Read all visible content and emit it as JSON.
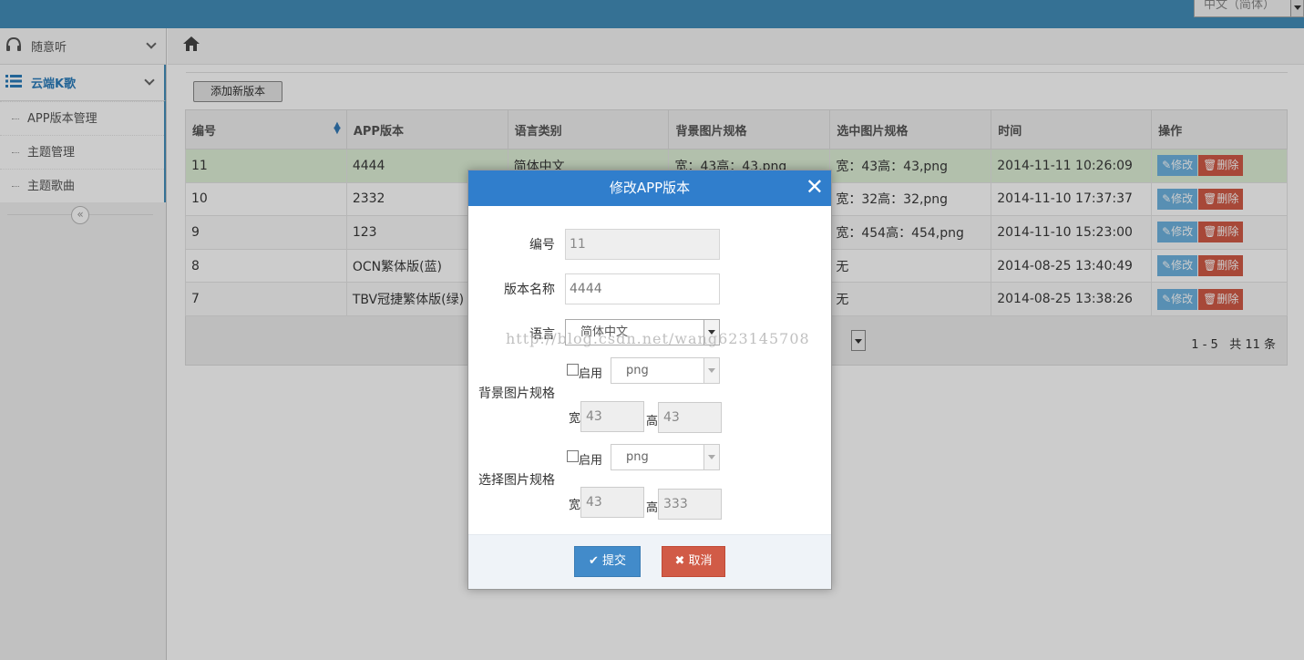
{
  "topbar": {
    "language": "中文（简体）"
  },
  "sidebar": {
    "items": [
      {
        "label": "随意听",
        "icon": "headphones-icon"
      },
      {
        "label": "云端K歌",
        "icon": "list-icon",
        "active": true
      }
    ],
    "submenu": [
      "APP版本管理",
      "主题管理",
      "主题歌曲"
    ],
    "collapse_icon": "«"
  },
  "toolbar": {
    "add_label": "添加新版本"
  },
  "table": {
    "headers": [
      "编号",
      "APP版本",
      "语言类别",
      "背景图片规格",
      "选中图片规格",
      "时间",
      "操作"
    ],
    "rows": [
      [
        "11",
        "4444",
        "简体中文",
        "宽：43高：43,png",
        "宽：43高：43,png",
        "2014-11-11 10:26:09"
      ],
      [
        "10",
        "2332",
        "",
        "",
        "宽：32高：32,png",
        "2014-11-10 17:37:37"
      ],
      [
        "9",
        "123",
        "",
        "",
        "宽：454高：454,png",
        "2014-11-10 15:23:00"
      ],
      [
        "8",
        "OCN繁体版(蓝)",
        "",
        "",
        "无",
        "2014-08-25 13:40:49"
      ],
      [
        "7",
        "TBV冠捷繁体版(绿)",
        "",
        "",
        "无",
        "2014-08-25 13:38:26"
      ]
    ],
    "edit_label": "修改",
    "delete_label": "删除"
  },
  "pager": {
    "info": "1 - 5   共 11 条"
  },
  "dialog": {
    "title": "修改APP版本",
    "close": "✕",
    "id_label": "编号",
    "id_value": "11",
    "name_label": "版本名称",
    "name_value": "4444",
    "lang_label": "语言",
    "lang_value": "简体中文",
    "bg_label": "背景图片规格",
    "sel_label": "选择图片规格",
    "enable_label": "启用",
    "format_value": "png",
    "width_label": "宽",
    "height_label": "高",
    "bg_width": "43",
    "bg_height": "43",
    "sel_width": "43",
    "sel_height": "333",
    "submit_label": "提交",
    "cancel_label": "取消"
  },
  "watermark": "http://blog.csdn.net/wang623145708"
}
